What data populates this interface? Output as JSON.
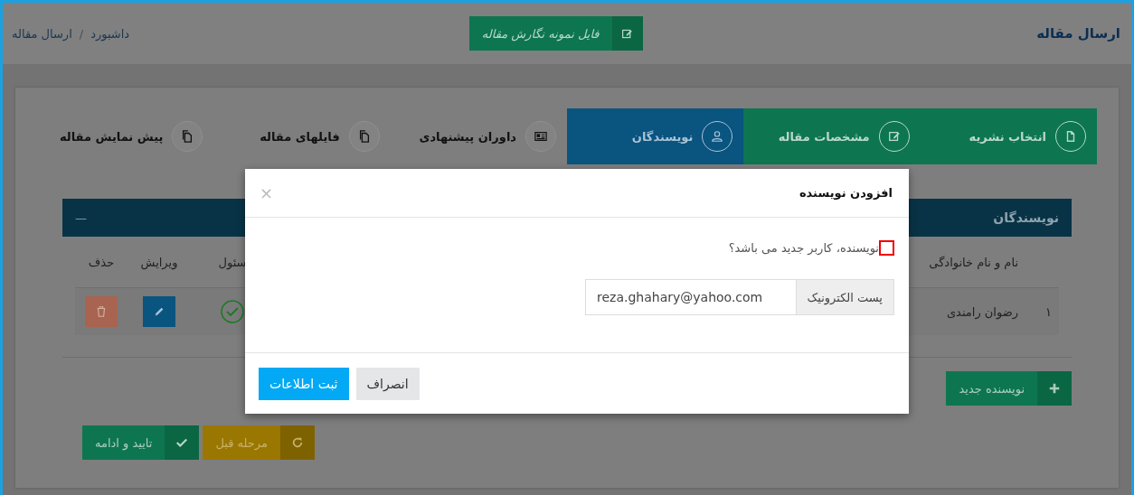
{
  "header": {
    "title": "ارسال مقاله",
    "sample_button": "فایل نمونه نگارش مقاله",
    "breadcrumb": [
      "داشبورد",
      "ارسال مقاله"
    ],
    "breadcrumb_separator": "/"
  },
  "steps": [
    {
      "label": "انتخاب نشریه",
      "done": true,
      "selected": false
    },
    {
      "label": "مشخصات مقاله",
      "done": true,
      "selected": false
    },
    {
      "label": "نویسندگان",
      "done": false,
      "selected": true
    },
    {
      "label": "داوران پیشنهادی",
      "done": false,
      "selected": false
    },
    {
      "label": "فایلهای مقاله",
      "done": false,
      "selected": false
    },
    {
      "label": "پیش نمایش مقاله",
      "done": false,
      "selected": false
    }
  ],
  "authors_panel": {
    "title": "نویسندگان",
    "collapse": "—",
    "columns": {
      "name": "نام و نام خانوادگی",
      "responsible": "سئول",
      "edit": "ویرایش",
      "delete": "حذف"
    },
    "rows": [
      {
        "index": "۱",
        "name": "رضوان رامندی",
        "responsible": true
      }
    ],
    "new_author_button": "نویسنده جدید"
  },
  "footer_buttons": [
    {
      "label": "مرحله قبل",
      "kind": "back"
    },
    {
      "label": "تایید و ادامه",
      "kind": "confirm"
    }
  ],
  "modal": {
    "title": "افزودن نویسنده",
    "close": "×",
    "new_user_checkbox": {
      "label": "نویسنده، کاربر جدید می باشد؟",
      "checked": false
    },
    "email": {
      "label": "پست الکترونیک",
      "value": "reza.ghahary@yahoo.com"
    },
    "buttons": [
      {
        "label": "انصراف",
        "kind": "secondary"
      },
      {
        "label": "ثبت اطلاعات",
        "kind": "primary"
      }
    ]
  }
}
